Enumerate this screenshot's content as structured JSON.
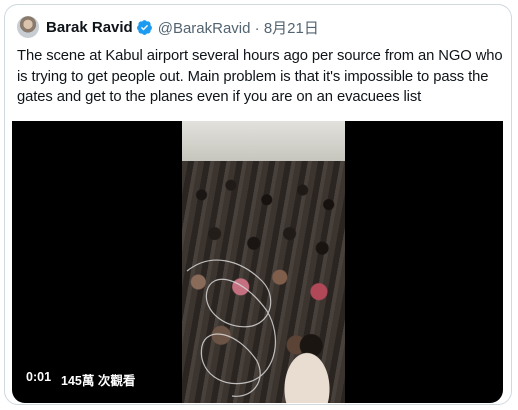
{
  "tweet": {
    "author_name": "Barak Ravid",
    "handle": "@BarakRavid",
    "separator": "·",
    "date": "8月21日",
    "text": "The scene at Kabul airport several hours ago per source from an NGO who is trying to get people out. Main problem is that it's impossible to pass the gates and get to the planes even if you are on an evacuees list",
    "verified_color": "#1d9bf0"
  },
  "video": {
    "elapsed": "0:01",
    "views": "145萬 次觀看"
  }
}
